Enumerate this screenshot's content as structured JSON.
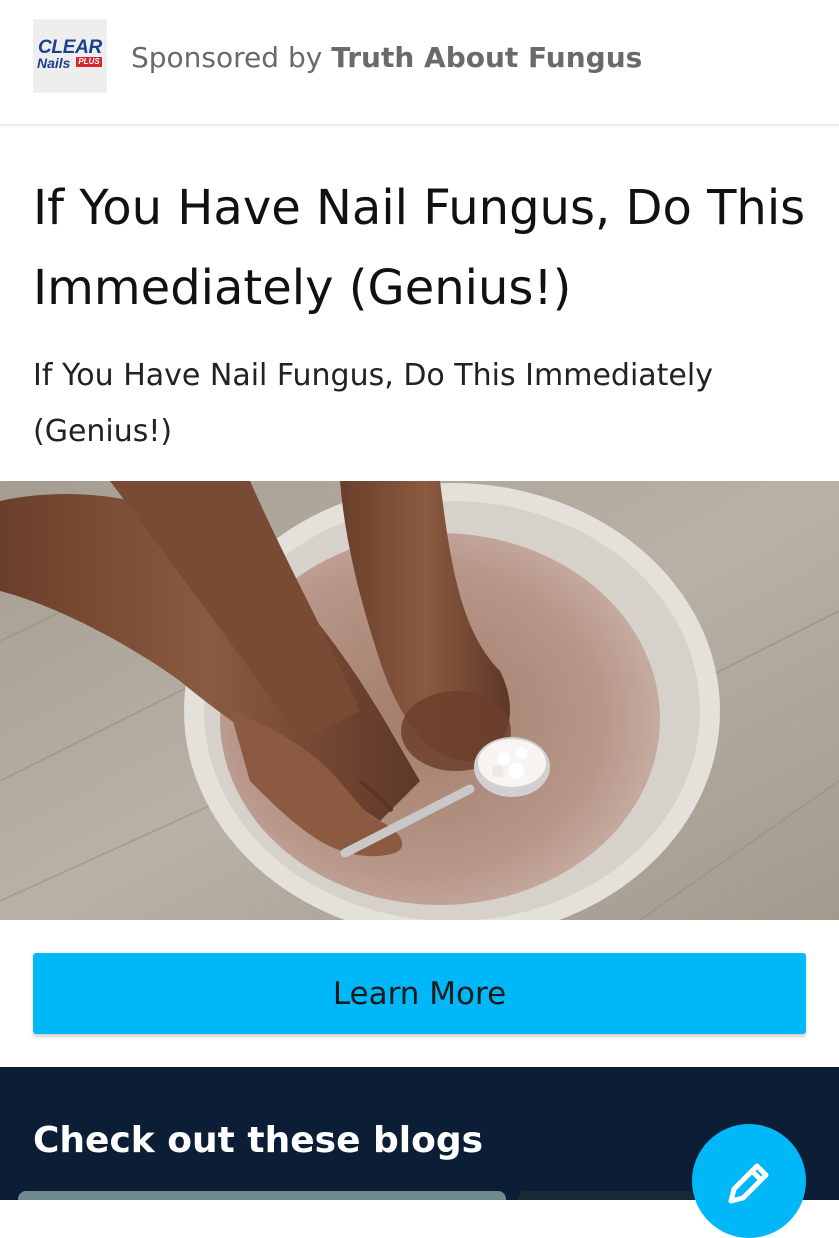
{
  "sponsor": {
    "logo": {
      "line1": "CLEAR",
      "line2": "Nails",
      "badge": "PLUS",
      "brand_color": "#1c3f8f",
      "badge_color": "#d7262d"
    },
    "prefix": "Sponsored by",
    "name": "Truth About Fungus"
  },
  "ad": {
    "headline": "If You Have Nail Fungus, Do This Immediately (Genius!)",
    "description": "If You Have Nail Fungus, Do This Immediately (Genius!)",
    "cta_label": "Learn More",
    "cta_color": "#00b7f8"
  },
  "blogs": {
    "heading": "Check out these blogs",
    "background": "#0c1e36"
  },
  "fab": {
    "icon": "pencil-icon"
  }
}
